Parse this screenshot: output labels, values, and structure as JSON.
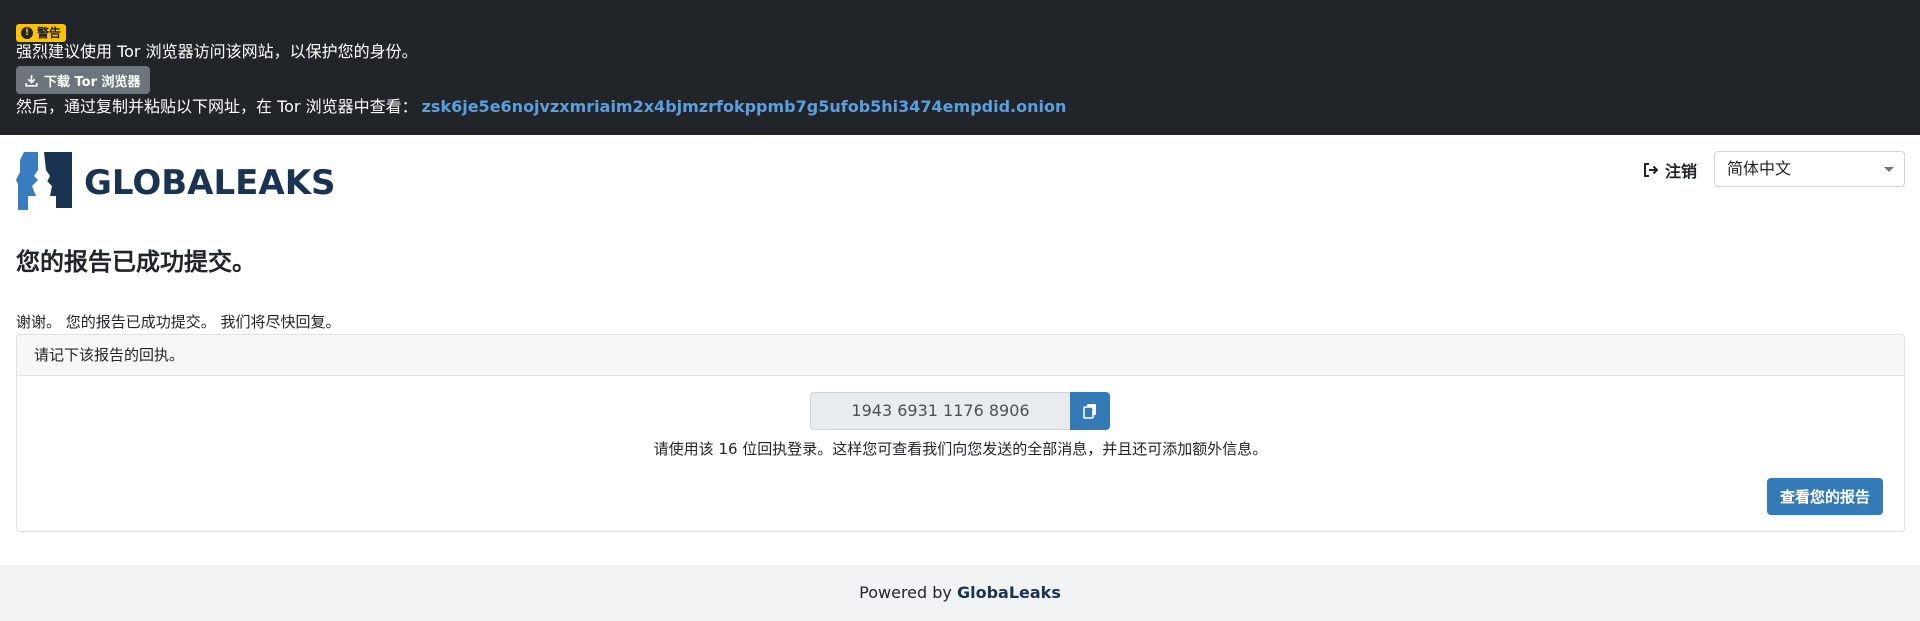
{
  "tor_banner": {
    "warning_badge": "警告",
    "message": "强烈建议使用 Tor 浏览器访问该网站，以保护您的身份。",
    "download_button": "下载 Tor 浏览器",
    "then_text": "然后，通过复制并粘贴以下网址，在 Tor 浏览器中查看：",
    "onion_address": "zsk6je5e6nojvzxmriaim2x4bjmzrfokppmb7g5ufob5hi3474empdid.onion"
  },
  "header": {
    "logo_text": "GLOBALEAKS",
    "logout_label": "注销",
    "language_selected": "简体中文"
  },
  "main": {
    "title": "您的报告已成功提交。",
    "thanks": "谢谢。 您的报告已成功提交。 我们将尽快回复。",
    "card_header": "请记下该报告的回执。",
    "receipt_code": "1943 6931 1176 8906",
    "receipt_help": "请使用该 16 位回执登录。这样您可查看我们向您发送的全部消息，并且还可添加额外信息。",
    "view_report_button": "查看您的报告"
  },
  "footer": {
    "powered_by": "Powered by",
    "brand": "GlobaLeaks"
  },
  "colors": {
    "banner_bg": "#212529",
    "warning": "#ffc107",
    "primary": "#337ab7",
    "brand_navy": "#1a3350",
    "logo_blue": "#3a7cc0",
    "link": "#5aa0e0"
  },
  "icons": [
    "warning-icon",
    "download-icon",
    "sign-out-icon",
    "chevron-down-icon",
    "copy-icon"
  ]
}
